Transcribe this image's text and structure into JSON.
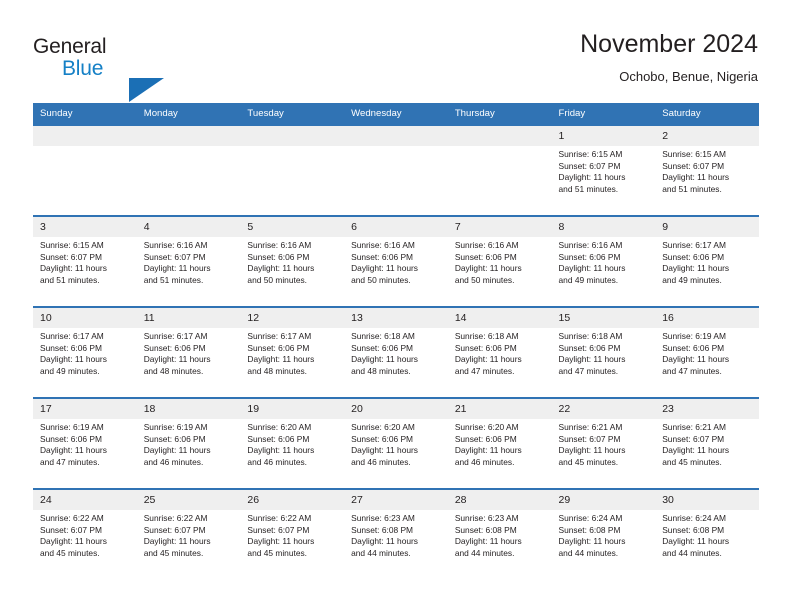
{
  "brand": {
    "name_line1": "General",
    "name_line2": "Blue",
    "triangle_color": "#1b6fb5",
    "text_color": "#231f20",
    "blue_text_color": "#1580c6"
  },
  "header": {
    "title": "November 2024",
    "subtitle": "Ochobo, Benue, Nigeria"
  },
  "theme": {
    "header_blue": "#3073b4",
    "daynum_band": "#efefef",
    "cell_bg": "#ffffff",
    "text": "#231f20"
  },
  "weekday_headers": [
    "Sunday",
    "Monday",
    "Tuesday",
    "Wednesday",
    "Thursday",
    "Friday",
    "Saturday"
  ],
  "weeks": [
    {
      "days": [
        {
          "num": "",
          "info": "",
          "empty": true
        },
        {
          "num": "",
          "info": "",
          "empty": true
        },
        {
          "num": "",
          "info": "",
          "empty": true
        },
        {
          "num": "",
          "info": "",
          "empty": true
        },
        {
          "num": "",
          "info": "",
          "empty": true
        },
        {
          "num": "1",
          "info": "Sunrise: 6:15 AM\nSunset: 6:07 PM\nDaylight: 11 hours\nand 51 minutes.",
          "empty": false
        },
        {
          "num": "2",
          "info": "Sunrise: 6:15 AM\nSunset: 6:07 PM\nDaylight: 11 hours\nand 51 minutes.",
          "empty": false
        }
      ]
    },
    {
      "days": [
        {
          "num": "3",
          "info": "Sunrise: 6:15 AM\nSunset: 6:07 PM\nDaylight: 11 hours\nand 51 minutes.",
          "empty": false
        },
        {
          "num": "4",
          "info": "Sunrise: 6:16 AM\nSunset: 6:07 PM\nDaylight: 11 hours\nand 51 minutes.",
          "empty": false
        },
        {
          "num": "5",
          "info": "Sunrise: 6:16 AM\nSunset: 6:06 PM\nDaylight: 11 hours\nand 50 minutes.",
          "empty": false
        },
        {
          "num": "6",
          "info": "Sunrise: 6:16 AM\nSunset: 6:06 PM\nDaylight: 11 hours\nand 50 minutes.",
          "empty": false
        },
        {
          "num": "7",
          "info": "Sunrise: 6:16 AM\nSunset: 6:06 PM\nDaylight: 11 hours\nand 50 minutes.",
          "empty": false
        },
        {
          "num": "8",
          "info": "Sunrise: 6:16 AM\nSunset: 6:06 PM\nDaylight: 11 hours\nand 49 minutes.",
          "empty": false
        },
        {
          "num": "9",
          "info": "Sunrise: 6:17 AM\nSunset: 6:06 PM\nDaylight: 11 hours\nand 49 minutes.",
          "empty": false
        }
      ]
    },
    {
      "days": [
        {
          "num": "10",
          "info": "Sunrise: 6:17 AM\nSunset: 6:06 PM\nDaylight: 11 hours\nand 49 minutes.",
          "empty": false
        },
        {
          "num": "11",
          "info": "Sunrise: 6:17 AM\nSunset: 6:06 PM\nDaylight: 11 hours\nand 48 minutes.",
          "empty": false
        },
        {
          "num": "12",
          "info": "Sunrise: 6:17 AM\nSunset: 6:06 PM\nDaylight: 11 hours\nand 48 minutes.",
          "empty": false
        },
        {
          "num": "13",
          "info": "Sunrise: 6:18 AM\nSunset: 6:06 PM\nDaylight: 11 hours\nand 48 minutes.",
          "empty": false
        },
        {
          "num": "14",
          "info": "Sunrise: 6:18 AM\nSunset: 6:06 PM\nDaylight: 11 hours\nand 47 minutes.",
          "empty": false
        },
        {
          "num": "15",
          "info": "Sunrise: 6:18 AM\nSunset: 6:06 PM\nDaylight: 11 hours\nand 47 minutes.",
          "empty": false
        },
        {
          "num": "16",
          "info": "Sunrise: 6:19 AM\nSunset: 6:06 PM\nDaylight: 11 hours\nand 47 minutes.",
          "empty": false
        }
      ]
    },
    {
      "days": [
        {
          "num": "17",
          "info": "Sunrise: 6:19 AM\nSunset: 6:06 PM\nDaylight: 11 hours\nand 47 minutes.",
          "empty": false
        },
        {
          "num": "18",
          "info": "Sunrise: 6:19 AM\nSunset: 6:06 PM\nDaylight: 11 hours\nand 46 minutes.",
          "empty": false
        },
        {
          "num": "19",
          "info": "Sunrise: 6:20 AM\nSunset: 6:06 PM\nDaylight: 11 hours\nand 46 minutes.",
          "empty": false
        },
        {
          "num": "20",
          "info": "Sunrise: 6:20 AM\nSunset: 6:06 PM\nDaylight: 11 hours\nand 46 minutes.",
          "empty": false
        },
        {
          "num": "21",
          "info": "Sunrise: 6:20 AM\nSunset: 6:06 PM\nDaylight: 11 hours\nand 46 minutes.",
          "empty": false
        },
        {
          "num": "22",
          "info": "Sunrise: 6:21 AM\nSunset: 6:07 PM\nDaylight: 11 hours\nand 45 minutes.",
          "empty": false
        },
        {
          "num": "23",
          "info": "Sunrise: 6:21 AM\nSunset: 6:07 PM\nDaylight: 11 hours\nand 45 minutes.",
          "empty": false
        }
      ]
    },
    {
      "days": [
        {
          "num": "24",
          "info": "Sunrise: 6:22 AM\nSunset: 6:07 PM\nDaylight: 11 hours\nand 45 minutes.",
          "empty": false
        },
        {
          "num": "25",
          "info": "Sunrise: 6:22 AM\nSunset: 6:07 PM\nDaylight: 11 hours\nand 45 minutes.",
          "empty": false
        },
        {
          "num": "26",
          "info": "Sunrise: 6:22 AM\nSunset: 6:07 PM\nDaylight: 11 hours\nand 45 minutes.",
          "empty": false
        },
        {
          "num": "27",
          "info": "Sunrise: 6:23 AM\nSunset: 6:08 PM\nDaylight: 11 hours\nand 44 minutes.",
          "empty": false
        },
        {
          "num": "28",
          "info": "Sunrise: 6:23 AM\nSunset: 6:08 PM\nDaylight: 11 hours\nand 44 minutes.",
          "empty": false
        },
        {
          "num": "29",
          "info": "Sunrise: 6:24 AM\nSunset: 6:08 PM\nDaylight: 11 hours\nand 44 minutes.",
          "empty": false
        },
        {
          "num": "30",
          "info": "Sunrise: 6:24 AM\nSunset: 6:08 PM\nDaylight: 11 hours\nand 44 minutes.",
          "empty": false
        }
      ]
    }
  ]
}
